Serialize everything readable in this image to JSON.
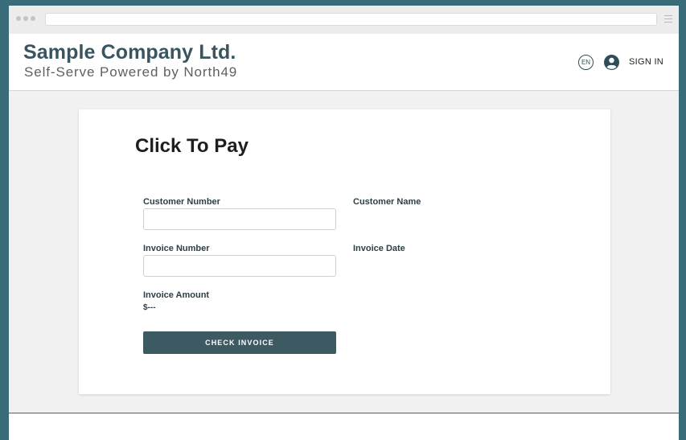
{
  "header": {
    "company_name": "Sample Company Ltd.",
    "tagline": "Self-Serve Powered by North49",
    "language": "EN",
    "sign_in": "SIGN IN"
  },
  "form": {
    "title": "Click To Pay",
    "customer_number_label": "Customer Number",
    "customer_number_value": "",
    "customer_name_label": "Customer Name",
    "invoice_number_label": "Invoice Number",
    "invoice_number_value": "",
    "invoice_date_label": "Invoice Date",
    "invoice_amount_label": "Invoice Amount",
    "invoice_amount_value": "$---",
    "check_button": "CHECK INVOICE"
  },
  "icons": {
    "window_controls": "traffic-light-dots",
    "browser_menu": "hamburger-menu-icon",
    "language": "globe-badge-icon",
    "user": "user-circle-icon"
  },
  "colors": {
    "page_background": "#3a6b78",
    "brand": "#385560",
    "button": "#3d5a63"
  }
}
